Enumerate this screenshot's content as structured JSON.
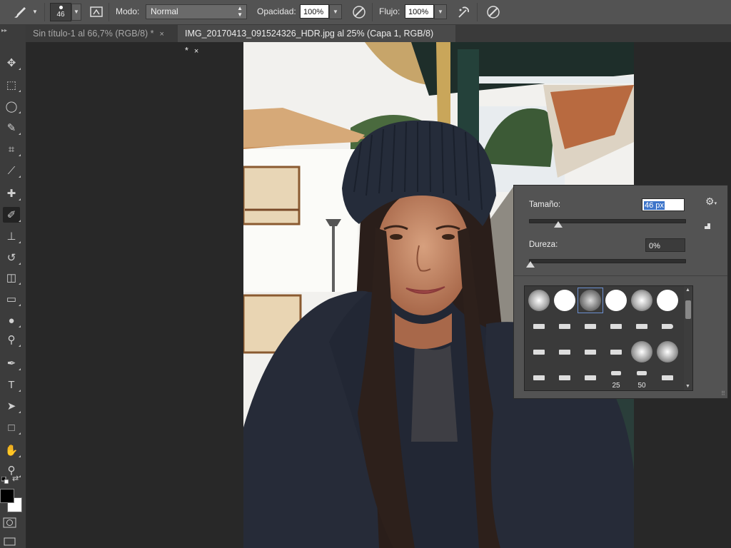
{
  "options_bar": {
    "brush_size": "46",
    "mode_label": "Modo:",
    "mode_value": "Normal",
    "opacity_label": "Opacidad:",
    "opacity_value": "100%",
    "flow_label": "Flujo:",
    "flow_value": "100%"
  },
  "tabs": [
    {
      "label": "Sin título-1 al 66,7% (RGB/8) *",
      "close": "×",
      "active": false
    },
    {
      "label": "IMG_20170413_091524326_HDR.jpg al 25% (Capa 1, RGB/8) *",
      "close": "×",
      "active": true
    }
  ],
  "tools": [
    {
      "name": "move-tool",
      "icon": "move-icon",
      "glyph": "✥"
    },
    {
      "name": "marquee-tool",
      "icon": "rectangular-marquee-icon",
      "glyph": "⬚"
    },
    {
      "name": "lasso-tool",
      "icon": "lasso-icon",
      "glyph": "◯"
    },
    {
      "name": "quick-selection-tool",
      "icon": "quick-selection-icon",
      "glyph": "✎"
    },
    {
      "name": "crop-tool",
      "icon": "crop-icon",
      "glyph": "⌗"
    },
    {
      "name": "eyedropper-tool",
      "icon": "eyedropper-icon",
      "glyph": "⟋"
    },
    {
      "name": "spot-healing-tool",
      "icon": "healing-brush-icon",
      "glyph": "✚"
    },
    {
      "name": "brush-tool",
      "icon": "brush-icon",
      "glyph": "✐"
    },
    {
      "name": "clone-stamp-tool",
      "icon": "clone-stamp-icon",
      "glyph": "⊥"
    },
    {
      "name": "history-brush-tool",
      "icon": "history-brush-icon",
      "glyph": "↺"
    },
    {
      "name": "eraser-tool",
      "icon": "eraser-icon",
      "glyph": "◫"
    },
    {
      "name": "gradient-tool",
      "icon": "gradient-icon",
      "glyph": "▭"
    },
    {
      "name": "blur-tool",
      "icon": "blur-drop-icon",
      "glyph": "●"
    },
    {
      "name": "dodge-tool",
      "icon": "dodge-icon",
      "glyph": "⚲"
    },
    {
      "name": "pen-tool",
      "icon": "pen-icon",
      "glyph": "✒"
    },
    {
      "name": "type-tool",
      "icon": "type-icon",
      "glyph": "T"
    },
    {
      "name": "path-selection-tool",
      "icon": "path-selection-icon",
      "glyph": "➤"
    },
    {
      "name": "rectangle-tool",
      "icon": "rectangle-shape-icon",
      "glyph": "□"
    },
    {
      "name": "hand-tool",
      "icon": "hand-icon",
      "glyph": "✋"
    },
    {
      "name": "zoom-tool",
      "icon": "zoom-icon",
      "glyph": "⚲"
    }
  ],
  "brush_panel": {
    "size_label": "Tamaño:",
    "size_value": "46 px",
    "size_fraction": 0.19,
    "hardness_label": "Dureza:",
    "hardness_value": "0%",
    "hardness_fraction": 0.0,
    "tip_numbers": {
      "t1": "25",
      "t2": "50"
    }
  },
  "colors": {
    "foreground": "#000000",
    "background": "#ffffff",
    "accent": "#3d74c9"
  }
}
